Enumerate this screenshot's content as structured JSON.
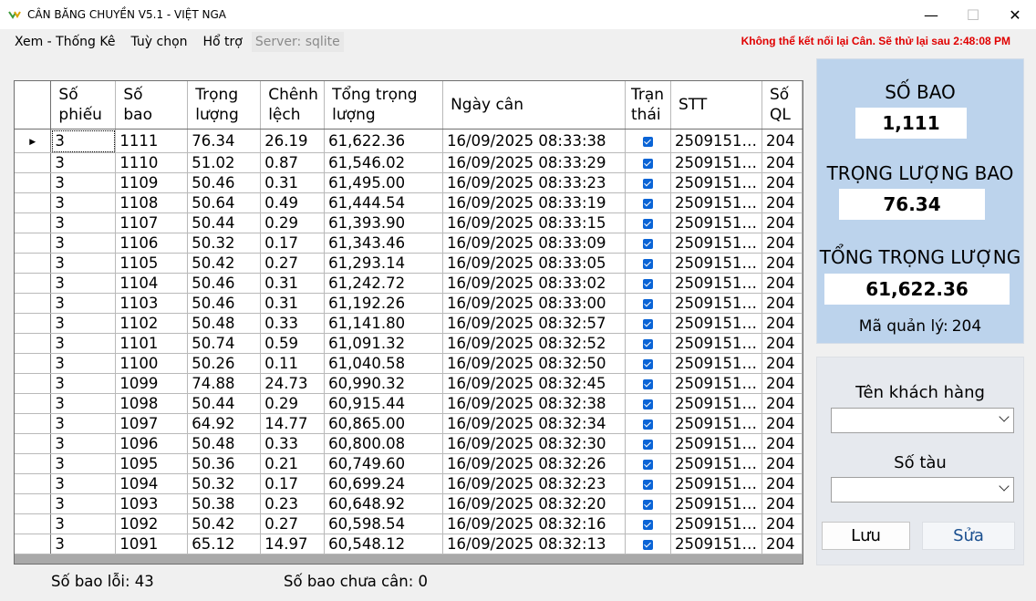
{
  "window": {
    "title": "CÂN BĂNG CHUYỀN V5.1 - VIỆT NGA",
    "minimize": "—",
    "maximize": "☐",
    "close": "✕"
  },
  "menu": {
    "items": [
      "Xem - Thống Kê",
      "Tuỳ chọn",
      "Hổ trợ"
    ],
    "server": "Server: sqlite"
  },
  "status": {
    "message": "Không thể kết nối lại Cân. Sẽ thử lại sau 2:48:08 PM",
    "color": "#e00000"
  },
  "grid": {
    "columns": [
      {
        "l1": "Số",
        "l2": "phiếu"
      },
      {
        "l1": "Số",
        "l2": "bao"
      },
      {
        "l1": "Trọng",
        "l2": "lượng"
      },
      {
        "l1": "Chênh",
        "l2": "lệch"
      },
      {
        "l1": "Tổng trọng",
        "l2": "lượng"
      },
      {
        "l1": "Ngày cân",
        "l2": ""
      },
      {
        "l1": "Trạn",
        "l2": "thái"
      },
      {
        "l1": "STT",
        "l2": ""
      },
      {
        "l1": "Số",
        "l2": "QL"
      }
    ],
    "current_row_marker": "▶",
    "rows": [
      {
        "sophieu": "3",
        "sobao": "1111",
        "trongluong": "76.34",
        "chenhlech": "26.19",
        "tong": "61,622.36",
        "ngay": "16/09/2025 08:33:38",
        "checked": true,
        "stt": "2509151…",
        "ql": "204"
      },
      {
        "sophieu": "3",
        "sobao": "1110",
        "trongluong": "51.02",
        "chenhlech": "0.87",
        "tong": "61,546.02",
        "ngay": "16/09/2025 08:33:29",
        "checked": true,
        "stt": "2509151…",
        "ql": "204"
      },
      {
        "sophieu": "3",
        "sobao": "1109",
        "trongluong": "50.46",
        "chenhlech": "0.31",
        "tong": "61,495.00",
        "ngay": "16/09/2025 08:33:23",
        "checked": true,
        "stt": "2509151…",
        "ql": "204"
      },
      {
        "sophieu": "3",
        "sobao": "1108",
        "trongluong": "50.64",
        "chenhlech": "0.49",
        "tong": "61,444.54",
        "ngay": "16/09/2025 08:33:19",
        "checked": true,
        "stt": "2509151…",
        "ql": "204"
      },
      {
        "sophieu": "3",
        "sobao": "1107",
        "trongluong": "50.44",
        "chenhlech": "0.29",
        "tong": "61,393.90",
        "ngay": "16/09/2025 08:33:15",
        "checked": true,
        "stt": "2509151…",
        "ql": "204"
      },
      {
        "sophieu": "3",
        "sobao": "1106",
        "trongluong": "50.32",
        "chenhlech": "0.17",
        "tong": "61,343.46",
        "ngay": "16/09/2025 08:33:09",
        "checked": true,
        "stt": "2509151…",
        "ql": "204"
      },
      {
        "sophieu": "3",
        "sobao": "1105",
        "trongluong": "50.42",
        "chenhlech": "0.27",
        "tong": "61,293.14",
        "ngay": "16/09/2025 08:33:05",
        "checked": true,
        "stt": "2509151…",
        "ql": "204"
      },
      {
        "sophieu": "3",
        "sobao": "1104",
        "trongluong": "50.46",
        "chenhlech": "0.31",
        "tong": "61,242.72",
        "ngay": "16/09/2025 08:33:02",
        "checked": true,
        "stt": "2509151…",
        "ql": "204"
      },
      {
        "sophieu": "3",
        "sobao": "1103",
        "trongluong": "50.46",
        "chenhlech": "0.31",
        "tong": "61,192.26",
        "ngay": "16/09/2025 08:33:00",
        "checked": true,
        "stt": "2509151…",
        "ql": "204"
      },
      {
        "sophieu": "3",
        "sobao": "1102",
        "trongluong": "50.48",
        "chenhlech": "0.33",
        "tong": "61,141.80",
        "ngay": "16/09/2025 08:32:57",
        "checked": true,
        "stt": "2509151…",
        "ql": "204"
      },
      {
        "sophieu": "3",
        "sobao": "1101",
        "trongluong": "50.74",
        "chenhlech": "0.59",
        "tong": "61,091.32",
        "ngay": "16/09/2025 08:32:52",
        "checked": true,
        "stt": "2509151…",
        "ql": "204"
      },
      {
        "sophieu": "3",
        "sobao": "1100",
        "trongluong": "50.26",
        "chenhlech": "0.11",
        "tong": "61,040.58",
        "ngay": "16/09/2025 08:32:50",
        "checked": true,
        "stt": "2509151…",
        "ql": "204"
      },
      {
        "sophieu": "3",
        "sobao": "1099",
        "trongluong": "74.88",
        "chenhlech": "24.73",
        "tong": "60,990.32",
        "ngay": "16/09/2025 08:32:45",
        "checked": true,
        "stt": "2509151…",
        "ql": "204"
      },
      {
        "sophieu": "3",
        "sobao": "1098",
        "trongluong": "50.44",
        "chenhlech": "0.29",
        "tong": "60,915.44",
        "ngay": "16/09/2025 08:32:38",
        "checked": true,
        "stt": "2509151…",
        "ql": "204"
      },
      {
        "sophieu": "3",
        "sobao": "1097",
        "trongluong": "64.92",
        "chenhlech": "14.77",
        "tong": "60,865.00",
        "ngay": "16/09/2025 08:32:34",
        "checked": true,
        "stt": "2509151…",
        "ql": "204"
      },
      {
        "sophieu": "3",
        "sobao": "1096",
        "trongluong": "50.48",
        "chenhlech": "0.33",
        "tong": "60,800.08",
        "ngay": "16/09/2025 08:32:30",
        "checked": true,
        "stt": "2509151…",
        "ql": "204"
      },
      {
        "sophieu": "3",
        "sobao": "1095",
        "trongluong": "50.36",
        "chenhlech": "0.21",
        "tong": "60,749.60",
        "ngay": "16/09/2025 08:32:26",
        "checked": true,
        "stt": "2509151…",
        "ql": "204"
      },
      {
        "sophieu": "3",
        "sobao": "1094",
        "trongluong": "50.32",
        "chenhlech": "0.17",
        "tong": "60,699.24",
        "ngay": "16/09/2025 08:32:23",
        "checked": true,
        "stt": "2509151…",
        "ql": "204"
      },
      {
        "sophieu": "3",
        "sobao": "1093",
        "trongluong": "50.38",
        "chenhlech": "0.23",
        "tong": "60,648.92",
        "ngay": "16/09/2025 08:32:20",
        "checked": true,
        "stt": "2509151…",
        "ql": "204"
      },
      {
        "sophieu": "3",
        "sobao": "1092",
        "trongluong": "50.42",
        "chenhlech": "0.27",
        "tong": "60,598.54",
        "ngay": "16/09/2025 08:32:16",
        "checked": true,
        "stt": "2509151…",
        "ql": "204"
      },
      {
        "sophieu": "3",
        "sobao": "1091",
        "trongluong": "65.12",
        "chenhlech": "14.97",
        "tong": "60,548.12",
        "ngay": "16/09/2025 08:32:13",
        "checked": true,
        "stt": "2509151…",
        "ql": "204"
      }
    ]
  },
  "info": {
    "so_bao_label": "SỐ BAO",
    "so_bao_value": "1,111",
    "trong_luong_label": "TRỌNG LƯỢNG BAO",
    "trong_luong_value": "76.34",
    "tong_label": "TỔNG TRỌNG LƯỢNG",
    "tong_value": "61,622.36",
    "ma_ql_label": "Mã quản lý:",
    "ma_ql_value": "204",
    "panel_color": "#bcd3ec"
  },
  "customer": {
    "ten_kh_label": "Tên khách hàng",
    "ten_kh_value": "",
    "so_tau_label": "Số tàu",
    "so_tau_value": "",
    "save_label": "Lưu",
    "edit_label": "Sửa"
  },
  "footer": {
    "so_bao_loi": "Số bao lỗi: 43",
    "so_bao_chua_can": "Số bao chưa cân: 0"
  }
}
